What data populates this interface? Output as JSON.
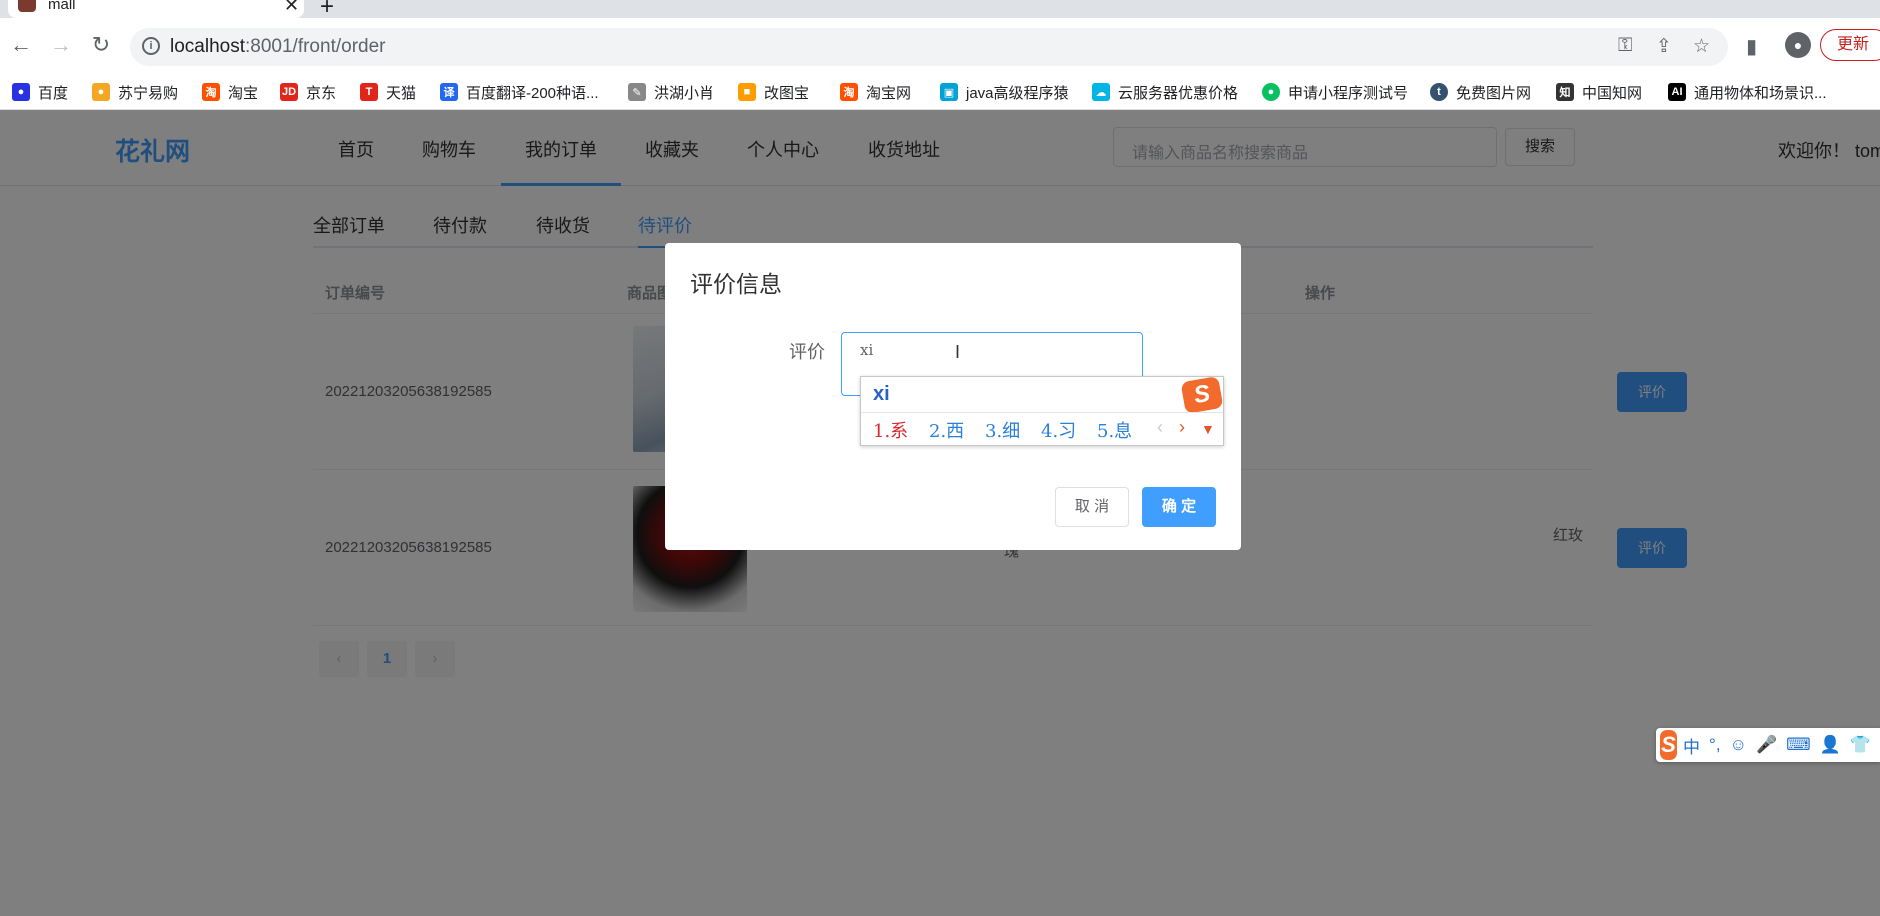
{
  "browser": {
    "tab_title": "mall",
    "url_host": "localhost",
    "url_rest": ":8001/front/order",
    "update_label": "更新",
    "bookmarks": [
      {
        "label": "百度",
        "icon": "baidu-icon",
        "color": "#2932e1"
      },
      {
        "label": "苏宁易购",
        "icon": "suning-icon",
        "color": "#f5a623"
      },
      {
        "label": "淘宝",
        "icon": "taobao-icon",
        "color": "#ff5000"
      },
      {
        "label": "京东",
        "icon": "jd-icon",
        "color": "#e1251b"
      },
      {
        "label": "天猫",
        "icon": "tmall-icon",
        "color": "#e1251b"
      },
      {
        "label": "百度翻译-200种语...",
        "icon": "translate-icon",
        "color": "#2468f2"
      },
      {
        "label": "洪湖小肖",
        "icon": "feather-icon",
        "color": "#888888"
      },
      {
        "label": "改图宝",
        "icon": "gaitubao-icon",
        "color": "#ff9d00"
      },
      {
        "label": "淘宝网",
        "icon": "taobao-icon",
        "color": "#ff5000"
      },
      {
        "label": "java高级程序猿",
        "icon": "bilibili-icon",
        "color": "#00a1d6"
      },
      {
        "label": "云服务器优惠价格",
        "icon": "cloud-icon",
        "color": "#00b5e5"
      },
      {
        "label": "申请小程序测试号",
        "icon": "wechat-icon",
        "color": "#07c160"
      },
      {
        "label": "免费图片网",
        "icon": "tumblr-icon",
        "color": "#34526f"
      },
      {
        "label": "中国知网",
        "icon": "cnki-icon",
        "color": "#333333"
      },
      {
        "label": "通用物体和场景识...",
        "icon": "ai-icon",
        "color": "#000000"
      }
    ]
  },
  "site": {
    "logo": "花礼网",
    "menu": [
      "首页",
      "购物车",
      "我的订单",
      "收藏夹",
      "个人中心",
      "收货地址"
    ],
    "search_placeholder": "请输入商品名称搜索商品",
    "search_button": "搜索",
    "welcome": "欢迎你！ tom"
  },
  "order_tabs": [
    "全部订单",
    "待付款",
    "待收货",
    "待评价"
  ],
  "table": {
    "headers": {
      "order_no": "订单编号",
      "product_img": "商品图",
      "action": "操作"
    },
    "rows": [
      {
        "order_no": "20221203205638192585",
        "name_right": "",
        "name_left": "",
        "action": "评价"
      },
      {
        "order_no": "20221203205638192585",
        "name_right": "红玫",
        "name_left": "瑰",
        "action": "评价"
      }
    ]
  },
  "pagination": {
    "prev": "‹",
    "current": "1",
    "next": "›"
  },
  "dialog": {
    "title": "评价信息",
    "label": "评价",
    "textarea_value": "xi",
    "cancel": "取 消",
    "confirm": "确 定"
  },
  "ime": {
    "composition": "xi",
    "candidates": [
      "1.系",
      "2.西",
      "3.细",
      "4.习",
      "5.息"
    ],
    "logo": "S",
    "status": [
      "中",
      "°,",
      "☺",
      "🎤",
      "⌨",
      "👤",
      "👕"
    ]
  }
}
